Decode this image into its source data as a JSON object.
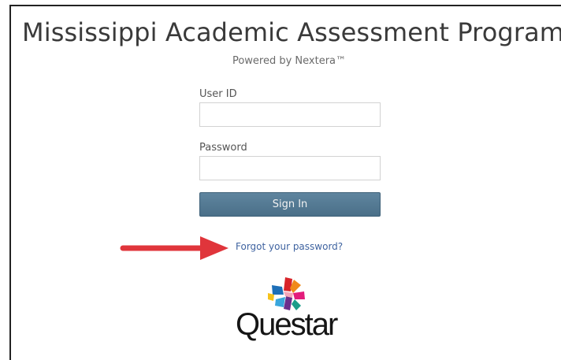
{
  "header": {
    "title": "Mississippi Academic Assessment Program",
    "subtitle": "Powered by Nextera™"
  },
  "form": {
    "user_id_label": "User ID",
    "user_id_value": "",
    "password_label": "Password",
    "password_value": "",
    "sign_in_label": "Sign In",
    "forgot_link": "Forgot your password?"
  },
  "annotation": {
    "arrow_color": "#e0353b",
    "arrow_icon": "right-arrow-icon"
  },
  "branding": {
    "logo_text": "Questar",
    "logo_icon": "questar-star-icon"
  },
  "colors": {
    "button": "#527891",
    "link": "#3f63a0",
    "title": "#3a3a3a"
  }
}
